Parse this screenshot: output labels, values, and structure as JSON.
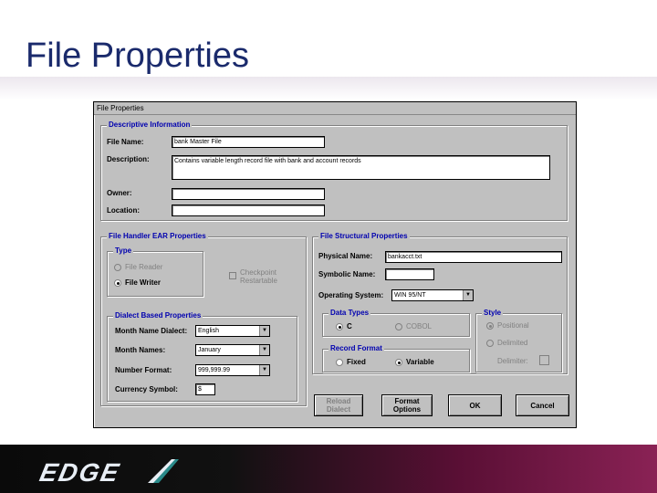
{
  "slide": {
    "title": "File Properties"
  },
  "logo": {
    "text": "EDGE"
  },
  "window": {
    "title": "File Properties"
  },
  "descriptive": {
    "group_label": "Descriptive Information",
    "file_name_label": "File Name:",
    "file_name_value": "bank Master File",
    "description_label": "Description:",
    "description_value": "Contains variable length record file with bank and account records",
    "owner_label": "Owner:",
    "owner_value": "",
    "location_label": "Location:",
    "location_value": ""
  },
  "handler": {
    "group_label": "File Handler EAR Properties",
    "type_group_label": "Type",
    "file_reader_label": "File Reader",
    "file_writer_label": "File Writer",
    "checkpoint_label_1": "Checkpoint",
    "checkpoint_label_2": "Restartable",
    "dialect_group_label": "Dialect Based Properties",
    "month_dialect_label": "Month Name Dialect:",
    "month_dialect_value": "English",
    "month_names_label": "Month Names:",
    "month_names_value": "January",
    "number_format_label": "Number Format:",
    "number_format_value": "999,999.99",
    "currency_label": "Currency Symbol:",
    "currency_value": "$"
  },
  "structural": {
    "group_label": "File Structural Properties",
    "physical_name_label": "Physical Name:",
    "physical_name_value": "bankacct.txt",
    "symbolic_name_label": "Symbolic Name:",
    "symbolic_name_value": "",
    "os_label": "Operating System:",
    "os_value": "WIN 95/NT",
    "data_types_label": "Data Types",
    "dt_c_label": "C",
    "dt_cobol_label": "COBOL",
    "record_format_label": "Record Format",
    "rf_fixed_label": "Fixed",
    "rf_variable_label": "Variable",
    "style_label": "Style",
    "style_positional_label": "Positional",
    "style_delimited_label": "Delimited",
    "delimiter_label": "Delimiter:"
  },
  "buttons": {
    "reload_1": "Reload",
    "reload_2": "Dialect",
    "format_1": "Format",
    "format_2": "Options",
    "ok": "OK",
    "cancel": "Cancel"
  }
}
